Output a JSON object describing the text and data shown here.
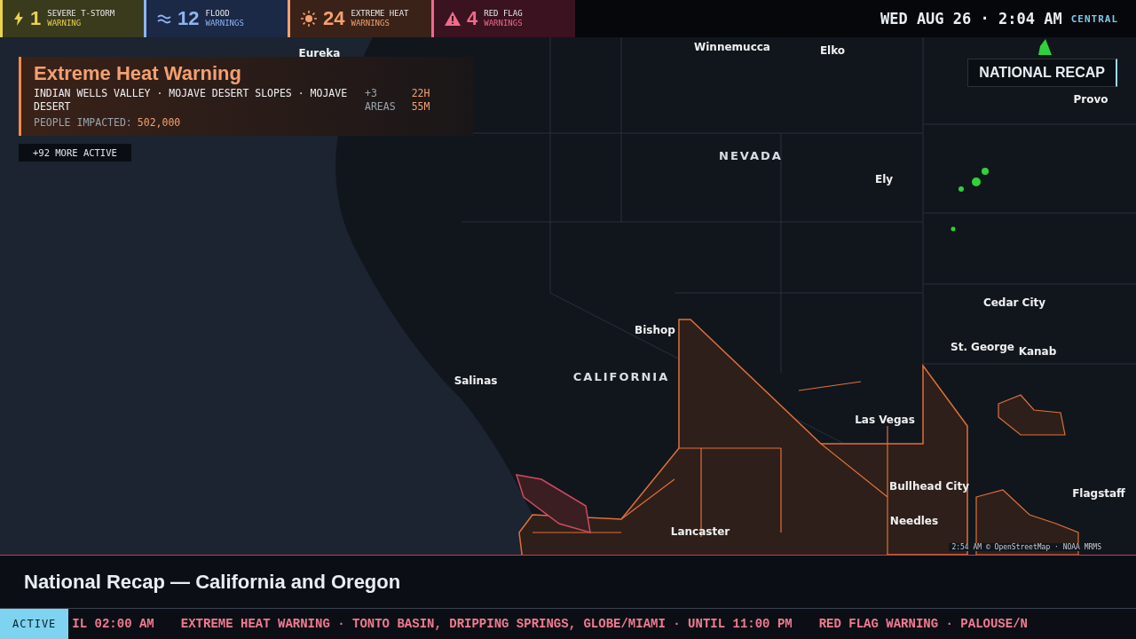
{
  "alerts": [
    {
      "kind": "storm",
      "count": "1",
      "line1": "SEVERE T-STORM",
      "line2": "WARNING",
      "color": "#e8d44d"
    },
    {
      "kind": "flood",
      "count": "12",
      "line1": "FLOOD",
      "line2": "WARNINGS",
      "color": "#8fb4f0"
    },
    {
      "kind": "heat",
      "count": "24",
      "line1": "EXTREME HEAT",
      "line2": "WARNINGS",
      "color": "#f4a070"
    },
    {
      "kind": "redflag",
      "count": "4",
      "line1": "RED FLAG",
      "line2": "WARNINGS",
      "color": "#f06a8a"
    }
  ],
  "clock": {
    "time": "WED AUG 26 · 2:04 AM",
    "zone": "CENTRAL"
  },
  "warning_card": {
    "title": "Extreme Heat Warning",
    "areas": "INDIAN WELLS VALLEY · MOJAVE DESERT SLOPES · MOJAVE DESERT",
    "extra_count": "+3",
    "extra_label": "AREAS",
    "remaining_hours": "22H",
    "remaining_minutes": "55M",
    "impact_label": "PEOPLE IMPACTED:",
    "impact_value": "502,000"
  },
  "more_active": "+92 MORE ACTIVE",
  "segment_tag": "NATIONAL RECAP",
  "map_labels": [
    {
      "kind": "city",
      "text": "Winnemucca"
    },
    {
      "kind": "city",
      "text": "Eureka"
    },
    {
      "kind": "city",
      "text": "Elko"
    },
    {
      "kind": "city",
      "text": "Provo"
    },
    {
      "kind": "state",
      "text": "NEVADA"
    },
    {
      "kind": "city",
      "text": "Ely"
    },
    {
      "kind": "city",
      "text": "Cedar City"
    },
    {
      "kind": "city",
      "text": "Bishop"
    },
    {
      "kind": "city",
      "text": "St. George"
    },
    {
      "kind": "city",
      "text": "Kanab"
    },
    {
      "kind": "state",
      "text": "CALIFORNIA"
    },
    {
      "kind": "city",
      "text": "Salinas"
    },
    {
      "kind": "city",
      "text": "Las Vegas"
    },
    {
      "kind": "city",
      "text": "Flagstaff"
    },
    {
      "kind": "city",
      "text": "Bullhead City"
    },
    {
      "kind": "city",
      "text": "Needles"
    },
    {
      "kind": "city",
      "text": "Lancaster"
    }
  ],
  "map_attribution": "2:54 AM © OpenStreetMap · NOAA MRMS",
  "headline": "National Recap — California and Oregon",
  "ticker": {
    "label": "ACTIVE",
    "items": [
      "IL 02:00 AM",
      "EXTREME HEAT WARNING · TONTO BASIN, DRIPPING SPRINGS, GLOBE/MIAMI · UNTIL 11:00 PM",
      "RED FLAG WARNING · PALOUSE/N"
    ]
  }
}
